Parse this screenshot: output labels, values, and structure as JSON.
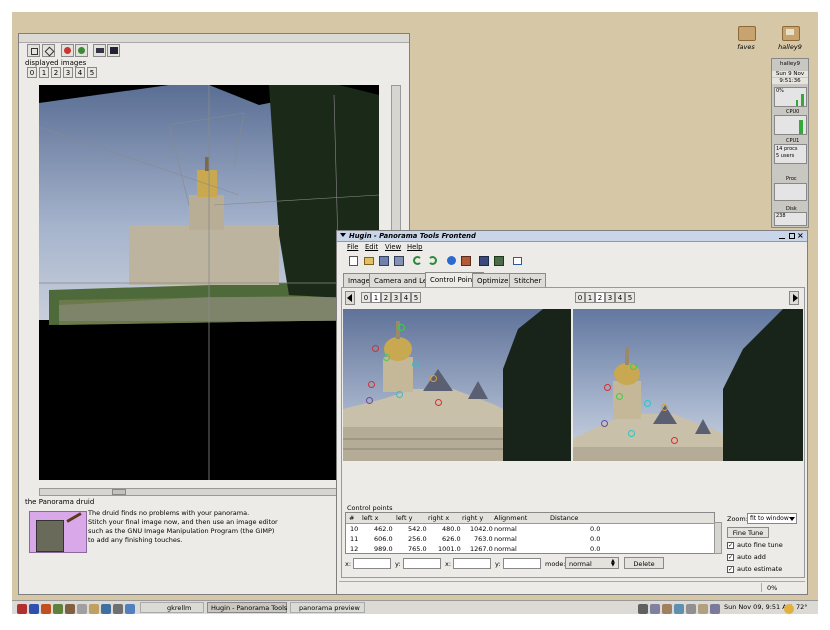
{
  "desktop": {
    "icons": [
      {
        "label": "faves"
      },
      {
        "label": "halley9"
      }
    ]
  },
  "preview_window": {
    "displayed_images_label": "displayed images",
    "image_buttons": [
      "0",
      "1",
      "2",
      "3",
      "4",
      "5"
    ],
    "druid_title": "the Panorama druid",
    "druid_lines": [
      "The druid finds no problems with your panorama.",
      "Stitch your final image now, and then use an image editor",
      "such as the GNU Image Manipulation Program (the GIMP)",
      "to add any finishing touches."
    ]
  },
  "gkrellm": {
    "host": "halley9",
    "date": "Sun  9 Nov",
    "time": "9:51:36",
    "cpu0_pct": "0%",
    "cpu0_label": "CPU0",
    "cpu1_label": "CPU1",
    "cpu1_info": [
      "14 procs",
      "5 users"
    ],
    "proc_label": "Proc",
    "disk_label": "Disk",
    "disk_value": "238"
  },
  "hugin": {
    "title": "Hugin - Panorama Tools Frontend",
    "menu": [
      "File",
      "Edit",
      "View",
      "Help"
    ],
    "tabs": [
      "Images",
      "Camera and Lens",
      "Control Points",
      "Optimizer",
      "Stitcher"
    ],
    "active_tab": "Control Points",
    "left_image_numbers": [
      "0",
      "1",
      "2",
      "3",
      "4",
      "5"
    ],
    "left_selected": "1",
    "right_image_numbers": [
      "0",
      "1",
      "2",
      "3",
      "4",
      "5"
    ],
    "right_selected": "2",
    "cp_section_label": "Control points",
    "table_headers": [
      "#",
      "left x",
      "left y",
      "right x",
      "right y",
      "Alignment",
      "Distance"
    ],
    "rows": [
      {
        "n": "10",
        "lx": "462.0",
        "ly": "542.0",
        "rx": "480.0",
        "ry": "1042.0",
        "align": "normal",
        "dist": "0.0"
      },
      {
        "n": "11",
        "lx": "606.0",
        "ly": "256.0",
        "rx": "626.0",
        "ry": "763.0",
        "align": "normal",
        "dist": "0.0"
      },
      {
        "n": "12",
        "lx": "989.0",
        "ly": "765.0",
        "rx": "1001.0",
        "ry": "1267.0",
        "align": "normal",
        "dist": "0.0"
      }
    ],
    "zoom_label": "Zoom:",
    "zoom_value": "fit to window",
    "fine_tune_label": "Fine Tune",
    "auto_fine_tune_label": "auto fine tune",
    "auto_add_label": "auto add",
    "auto_estimate_label": "auto estimate",
    "x_label": "x:",
    "y_label": "y:",
    "mode_label": "mode:",
    "mode_value": "normal",
    "delete_label": "Delete",
    "status_percent": "0%"
  },
  "taskbar": {
    "tasks": [
      {
        "label": "gkrellm"
      },
      {
        "label": "Hugin - Panorama Tools"
      },
      {
        "label": "panorama preview"
      }
    ],
    "clock": "Sun Nov 09,  9:51 AM",
    "temperature": "72°"
  },
  "colors": {
    "desktop": "#d6c7a6",
    "window_bg": "#ecebe7",
    "titlebar_active": "#c9d6ea",
    "marker_green": "#3ad04a",
    "marker_red": "#d43030",
    "marker_cyan": "#33c2c2",
    "marker_orange": "#e0a020"
  }
}
